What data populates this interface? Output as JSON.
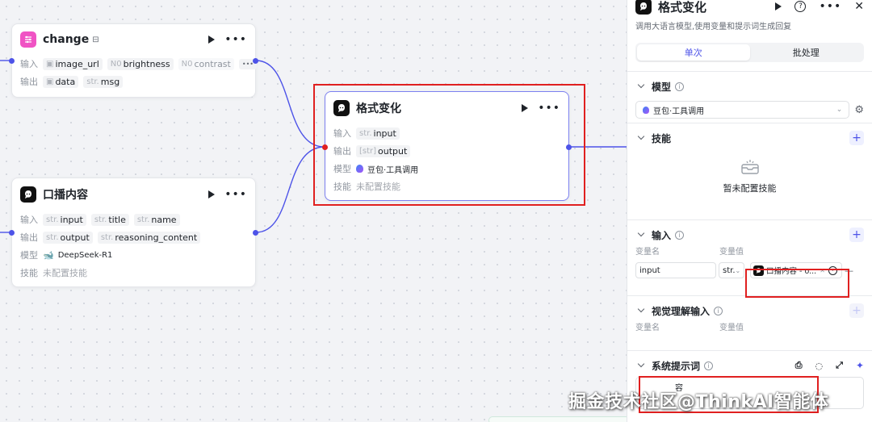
{
  "colors": {
    "accent": "#4d53e8",
    "highlight": "#e02020",
    "change_icon": "#f053c4"
  },
  "nodes": {
    "change": {
      "title": "change",
      "input_label": "输入",
      "output_label": "输出",
      "inputs": [
        {
          "type": "",
          "name": "image_url"
        },
        {
          "type": "N0",
          "name": "brightness"
        },
        {
          "type": "N0",
          "name": "contrast"
        }
      ],
      "outputs": [
        {
          "type": "",
          "name": "data"
        },
        {
          "type": "str.",
          "name": "msg"
        }
      ]
    },
    "broadcast": {
      "title": "口播内容",
      "input_label": "输入",
      "output_label": "输出",
      "model_label": "模型",
      "skill_label": "技能",
      "inputs": [
        {
          "type": "str.",
          "name": "input"
        },
        {
          "type": "str.",
          "name": "title"
        },
        {
          "type": "str.",
          "name": "name"
        }
      ],
      "outputs": [
        {
          "type": "str.",
          "name": "output"
        },
        {
          "type": "str.",
          "name": "reasoning_content"
        }
      ],
      "model": "DeepSeek-R1",
      "skill": "未配置技能"
    },
    "format": {
      "title": "格式变化",
      "input_label": "输入",
      "output_label": "输出",
      "model_label": "模型",
      "skill_label": "技能",
      "input": {
        "type": "str.",
        "name": "input"
      },
      "output": {
        "type": "[str]",
        "name": "output"
      },
      "model": "豆包·工具调用",
      "skill": "未配置技能"
    }
  },
  "panel": {
    "title": "格式变化",
    "description": "调用大语言模型,使用变量和提示词生成回复",
    "tabs": [
      {
        "label": "单次",
        "active": true
      },
      {
        "label": "批处理",
        "active": false
      }
    ],
    "model_section": {
      "label": "模型",
      "value": "豆包·工具调用"
    },
    "skill_section": {
      "label": "技能",
      "empty_text": "暂未配置技能"
    },
    "input_section": {
      "label": "输入",
      "col_name": "变量名",
      "col_value": "变量值",
      "row": {
        "name": "input",
        "type": "str.",
        "ref": "口播内容 - o..."
      }
    },
    "vision_section": {
      "label": "视觉理解输入",
      "col_name": "变量名",
      "col_value": "变量值"
    },
    "prompt_section": {
      "label": "系统提示词",
      "content": "容"
    }
  },
  "watermark": "掘金技术社区@ThinkAI智能体"
}
